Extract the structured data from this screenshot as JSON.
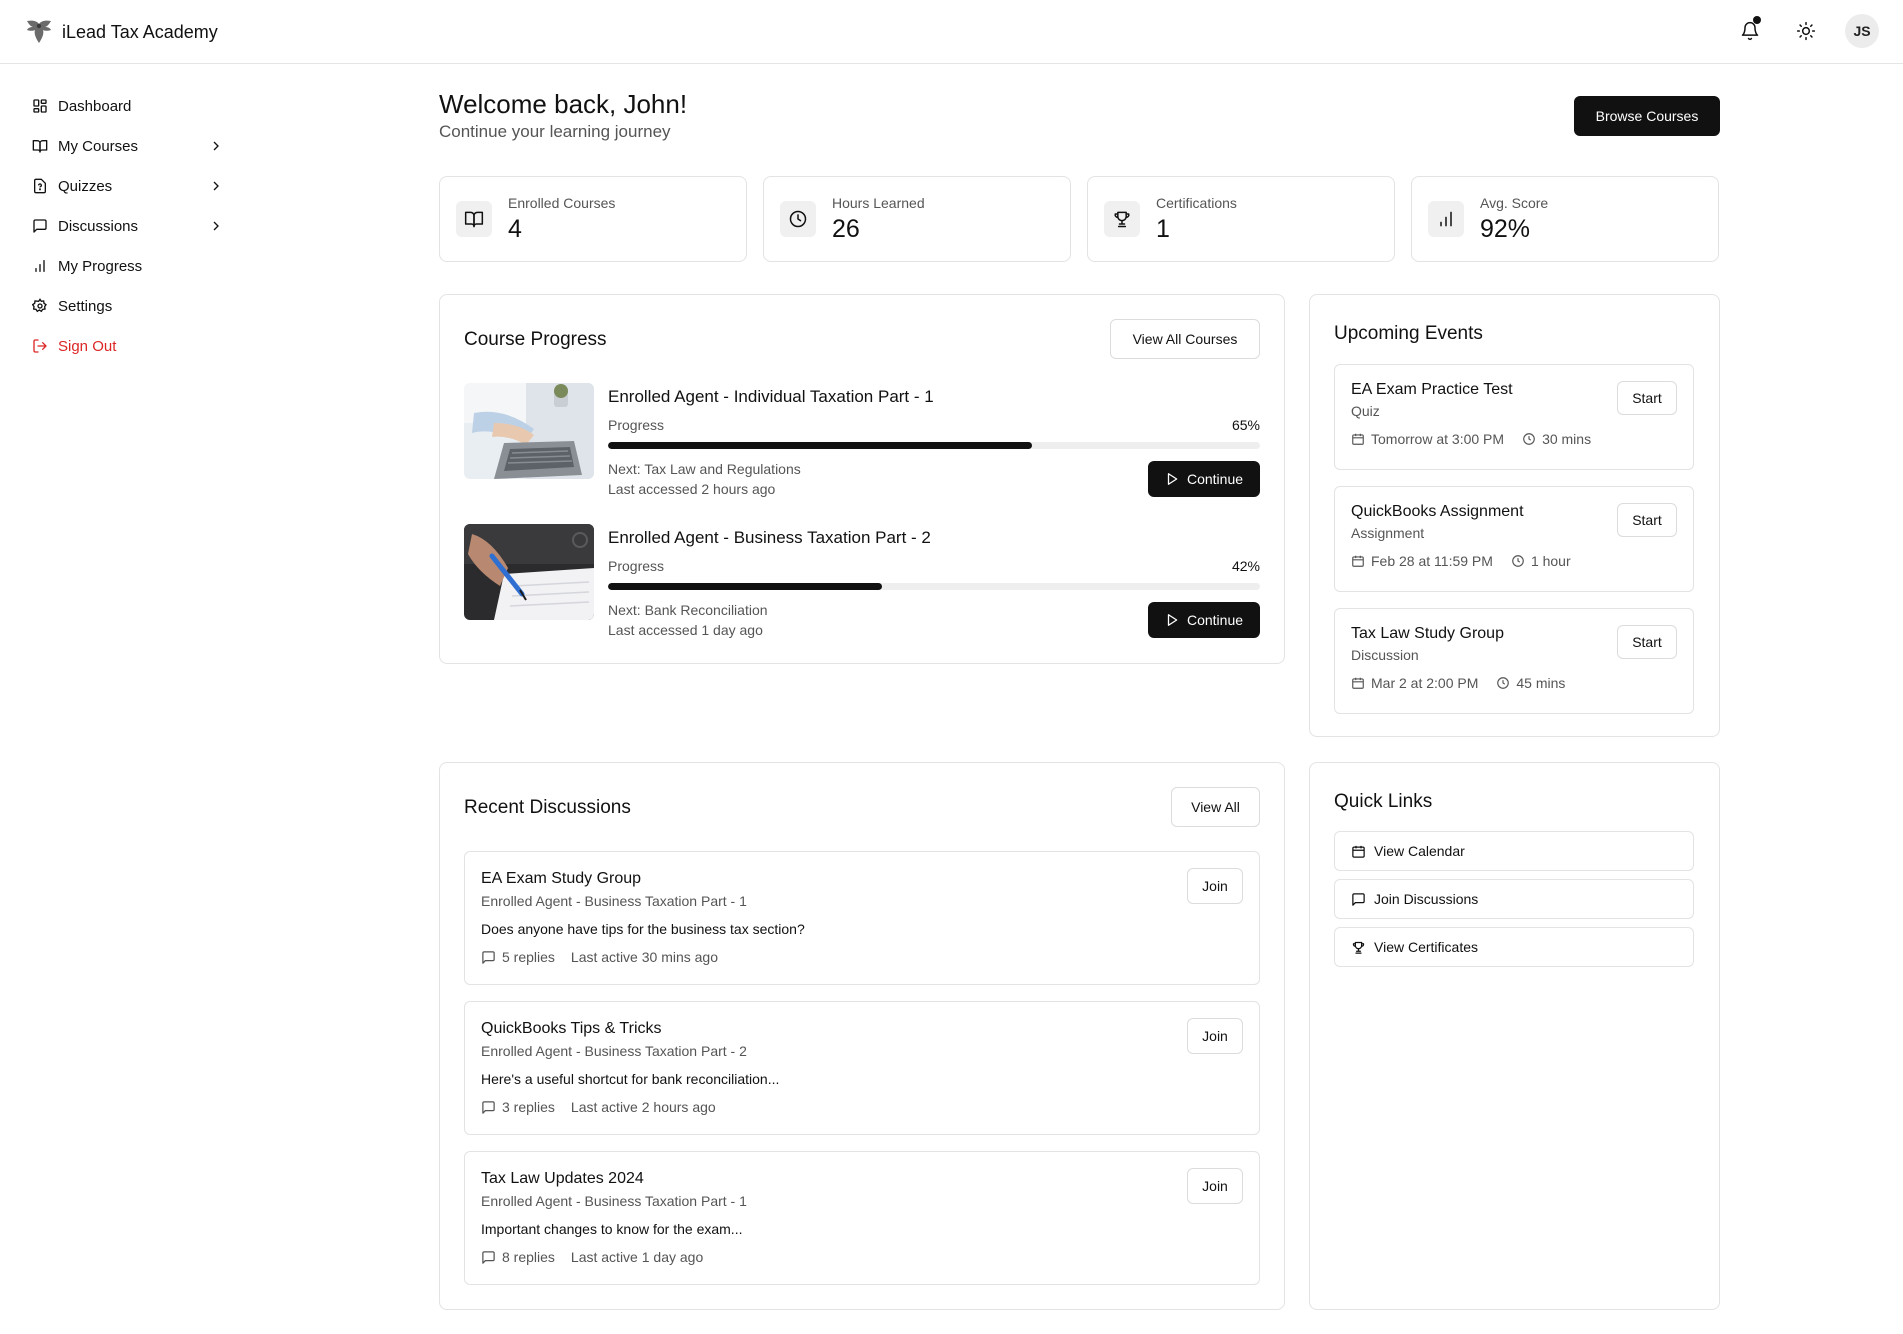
{
  "header": {
    "brand_name": "iLead Tax Academy",
    "avatar_initials": "JS"
  },
  "sidebar": {
    "items": [
      {
        "label": "Dashboard"
      },
      {
        "label": "My Courses"
      },
      {
        "label": "Quizzes"
      },
      {
        "label": "Discussions"
      },
      {
        "label": "My Progress"
      },
      {
        "label": "Settings"
      },
      {
        "label": "Sign Out"
      }
    ]
  },
  "welcome": {
    "title": "Welcome back, John!",
    "subtitle": "Continue your learning journey",
    "browse_label": "Browse Courses"
  },
  "stats": [
    {
      "label": "Enrolled Courses",
      "value": "4",
      "icon": "book-open-icon"
    },
    {
      "label": "Hours Learned",
      "value": "26",
      "icon": "clock-icon"
    },
    {
      "label": "Certifications",
      "value": "1",
      "icon": "trophy-icon"
    },
    {
      "label": "Avg. Score",
      "value": "92%",
      "icon": "bar-chart-icon"
    }
  ],
  "course_progress": {
    "title": "Course Progress",
    "view_all_label": "View All Courses",
    "courses": [
      {
        "title": "Enrolled Agent - Individual Taxation Part - 1",
        "progress_label": "Progress",
        "percent": "65%",
        "progress_fraction": 0.65,
        "next": "Next: Tax Law and Regulations",
        "last_accessed": "Last accessed 2 hours ago",
        "continue_label": "Continue"
      },
      {
        "title": "Enrolled Agent - Business Taxation Part - 2",
        "progress_label": "Progress",
        "percent": "42%",
        "progress_fraction": 0.42,
        "next": "Next: Bank Reconciliation",
        "last_accessed": "Last accessed 1 day ago",
        "continue_label": "Continue"
      }
    ]
  },
  "upcoming_events": {
    "title": "Upcoming Events",
    "events": [
      {
        "title": "EA Exam Practice Test",
        "type": "Quiz",
        "date": "Tomorrow at 3:00 PM",
        "duration": "30 mins",
        "start_label": "Start"
      },
      {
        "title": "QuickBooks Assignment",
        "type": "Assignment",
        "date": "Feb 28 at 11:59 PM",
        "duration": "1 hour",
        "start_label": "Start"
      },
      {
        "title": "Tax Law Study Group",
        "type": "Discussion",
        "date": "Mar 2 at 2:00 PM",
        "duration": "45 mins",
        "start_label": "Start"
      }
    ]
  },
  "recent_discussions": {
    "title": "Recent Discussions",
    "view_all_label": "View All",
    "items": [
      {
        "title": "EA Exam Study Group",
        "course": "Enrolled Agent - Business Taxation Part - 1",
        "text": "Does anyone have tips for the business tax section?",
        "replies": "5 replies",
        "last_active": "Last active 30 mins ago",
        "join_label": "Join"
      },
      {
        "title": "QuickBooks Tips & Tricks",
        "course": "Enrolled Agent - Business Taxation Part - 2",
        "text": "Here's a useful shortcut for bank reconciliation...",
        "replies": "3 replies",
        "last_active": "Last active 2 hours ago",
        "join_label": "Join"
      },
      {
        "title": "Tax Law Updates 2024",
        "course": "Enrolled Agent - Business Taxation Part - 1",
        "text": "Important changes to know for the exam...",
        "replies": "8 replies",
        "last_active": "Last active 1 day ago",
        "join_label": "Join"
      }
    ]
  },
  "quick_links": {
    "title": "Quick Links",
    "links": [
      {
        "label": "View Calendar"
      },
      {
        "label": "Join Discussions"
      },
      {
        "label": "View Certificates"
      }
    ]
  },
  "colors": {
    "primary": "#111111",
    "danger": "#dc2626",
    "border": "#e3e3e3",
    "muted_text": "#555555"
  }
}
